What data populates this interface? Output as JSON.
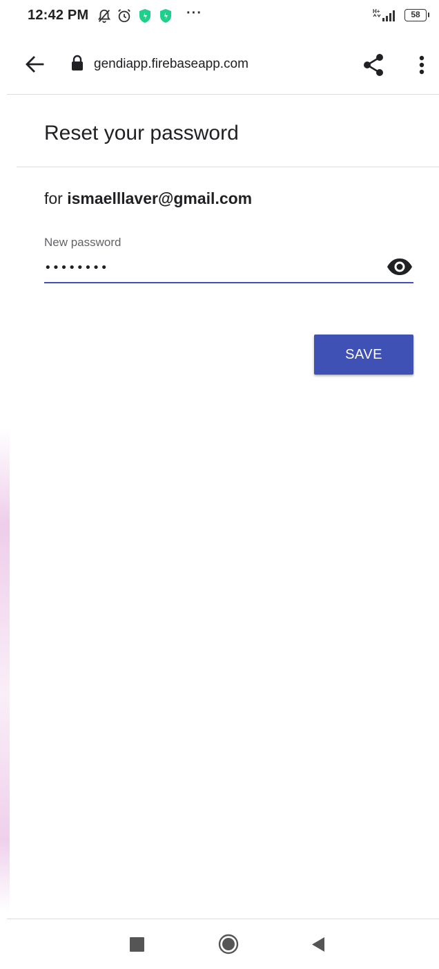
{
  "status_bar": {
    "time": "12:42 PM",
    "icons": [
      "notifications-off-icon",
      "alarm-icon",
      "shield-app-icon",
      "shield-app-icon",
      "more-notifications-icon"
    ],
    "more_dots": "···",
    "network_label": "H+",
    "battery": "58",
    "accent_green": "#1fcf8a"
  },
  "browser": {
    "url": "gendiapp.firebaseapp.com",
    "back_icon": "arrow-back-icon",
    "lock_icon": "lock-icon",
    "share_icon": "share-icon",
    "menu_icon": "more-vert-icon"
  },
  "page": {
    "title": "Reset your password",
    "for_prefix": "for ",
    "email": "ismaelllaver@gmail.com",
    "password_label": "New password",
    "password_value": "••••••••",
    "show_password_icon": "eye-icon",
    "save_label": "SAVE",
    "accent": "#3f51b5"
  },
  "nav_bar": {
    "buttons": [
      "recents-square-icon",
      "home-circle-icon",
      "back-triangle-icon"
    ]
  }
}
